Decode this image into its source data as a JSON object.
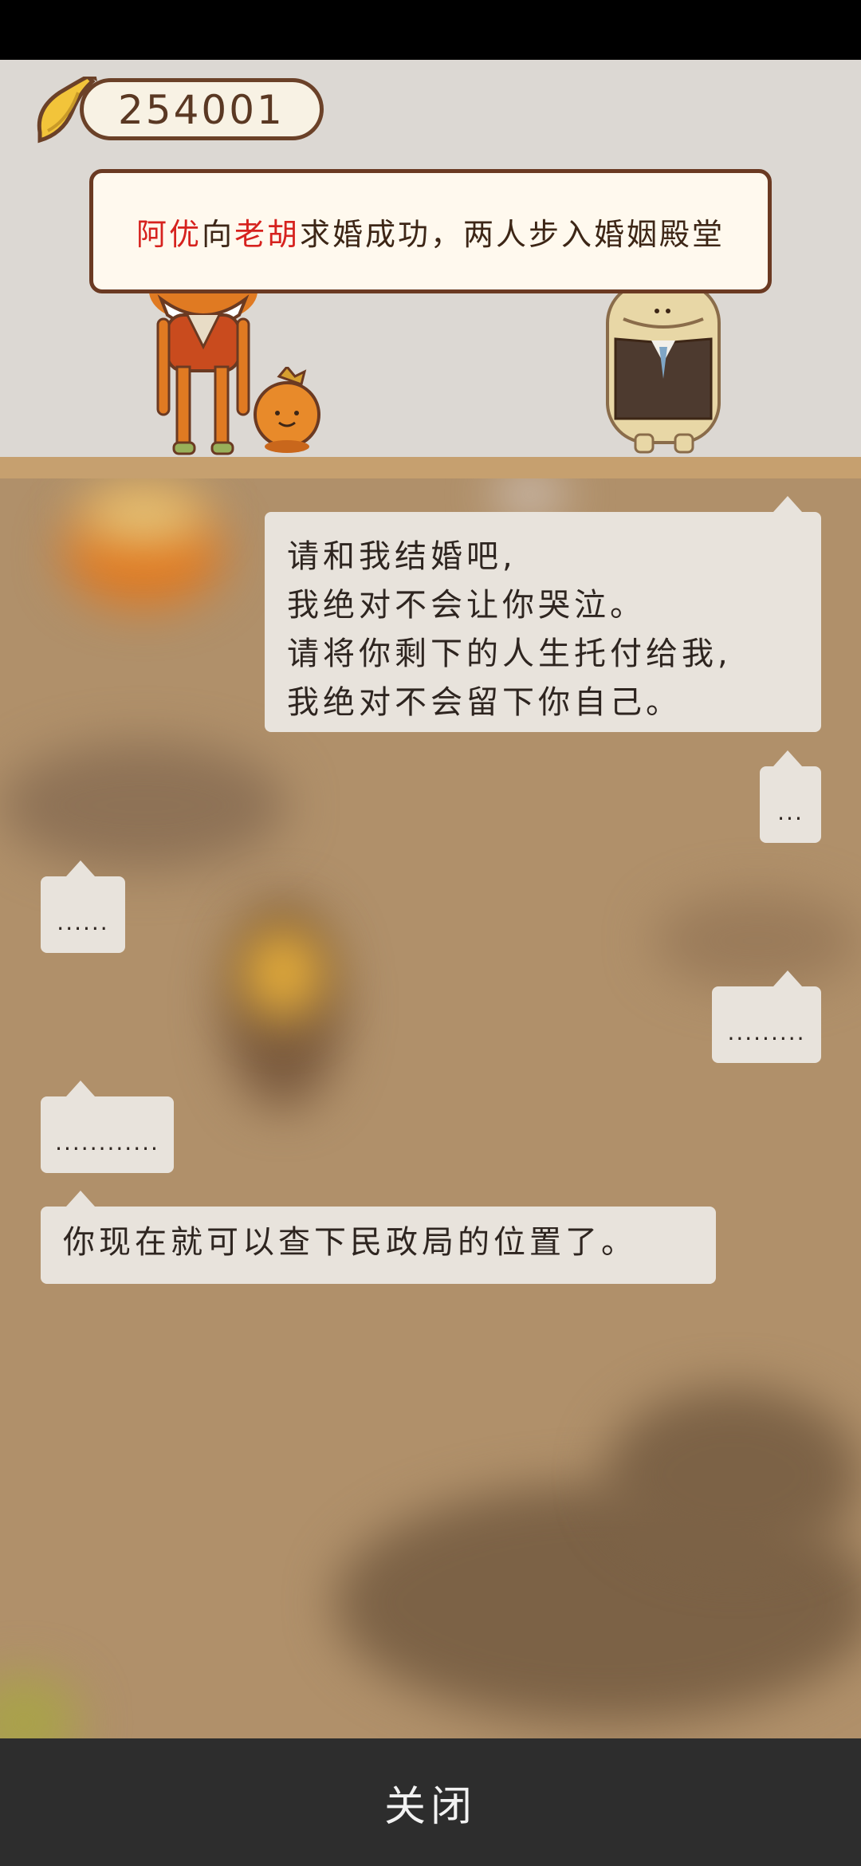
{
  "coin_counter": {
    "value": "254001",
    "icon": "banana-icon"
  },
  "event_banner": {
    "parts": [
      {
        "text": "阿优",
        "highlight": true
      },
      {
        "text": "向",
        "highlight": false
      },
      {
        "text": "老胡",
        "highlight": true
      },
      {
        "text": "求婚成功，两人步入婚姻殿堂",
        "highlight": false
      }
    ],
    "highlight_color": "#d6221e"
  },
  "messages": [
    {
      "side": "right",
      "lines": [
        "请和我结婚吧,",
        "我绝对不会让你哭泣。",
        "请将你剩下的人生托付给我,",
        "我绝对不会留下你自己。"
      ]
    },
    {
      "side": "right",
      "lines": [
        "..."
      ]
    },
    {
      "side": "left",
      "lines": [
        "......"
      ]
    },
    {
      "side": "right",
      "lines": [
        "........."
      ]
    },
    {
      "side": "left",
      "lines": [
        "............"
      ]
    },
    {
      "side": "left",
      "lines": [
        "你现在就可以查下民政局的位置了。"
      ]
    }
  ],
  "close_button": {
    "label": "关闭"
  },
  "colors": {
    "bubble": "#e8e3dc",
    "close_bar": "#2d2d2d",
    "banner_border": "#6b3a22"
  }
}
